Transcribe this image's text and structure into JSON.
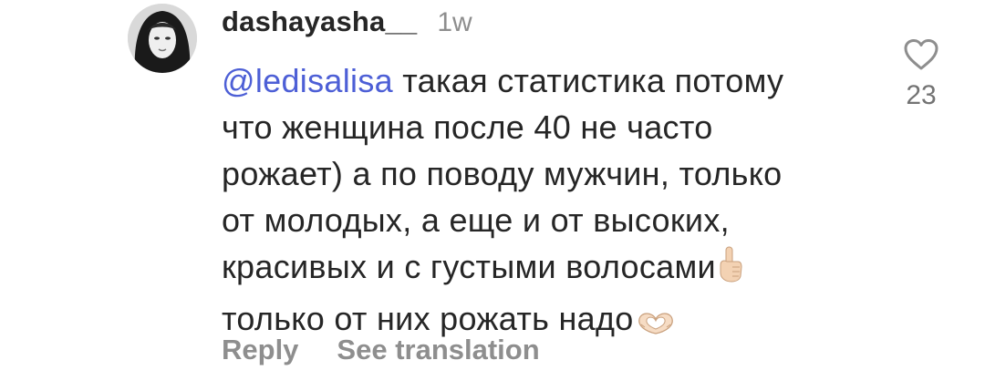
{
  "comment": {
    "username": "dashayasha__",
    "timestamp": "1w",
    "mention": "ledisalisa",
    "mention_prefix": "@",
    "text_lines": [
      " такая статистика потому",
      "что женщина после 40 не часто",
      "рожает) а по поводу мужчин, только",
      "от молодых, а еще и от высоких,",
      "красивых и с густыми волосами",
      "только от них рожать надо"
    ],
    "line5_emoji": "pointing-up-hand-emoji",
    "line6_emoji": "heart-hands-emoji",
    "like_count": "23",
    "actions": {
      "reply": "Reply",
      "see_translation": "See translation"
    },
    "icons": {
      "avatar": "profile-photo",
      "like": "heart-outline-icon"
    },
    "colors": {
      "text": "#262626",
      "mention": "#4d5fd6",
      "muted": "#8e8e8e"
    }
  }
}
